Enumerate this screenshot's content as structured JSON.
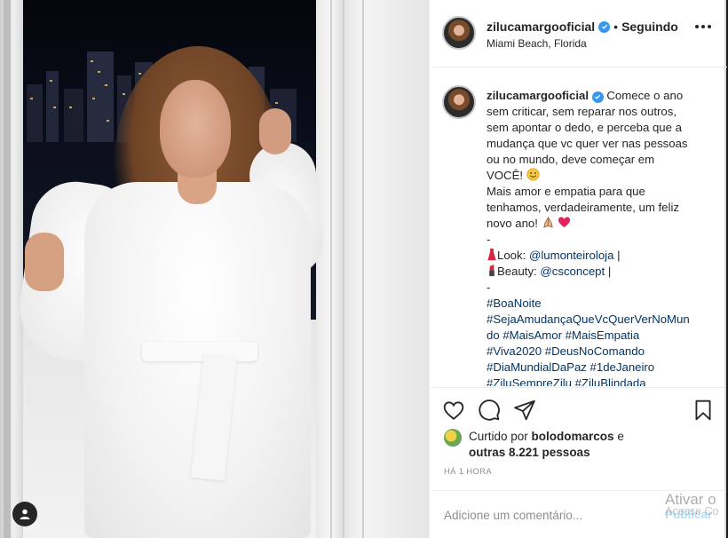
{
  "post": {
    "username": "zilucamargooficial",
    "separator": "•",
    "follow_status": "Seguindo",
    "location": "Miami Beach, Florida",
    "caption_lines": [
      "Comece o ano",
      "sem criticar, sem reparar nos outros,",
      "sem apontar o dedo, e perceba que a",
      "mudança que vc quer ver nas pessoas",
      "ou no mundo, deve começar em",
      "VOCÊ!",
      "Mais amor e empatia para que",
      "tenhamos, verdadeiramente, um feliz",
      "novo ano!",
      "-",
      "Look: ",
      "@lumonteiroloja",
      " |",
      "Beauty: ",
      "@csconcept",
      " |",
      "-"
    ],
    "hashtags": [
      "#BoaNoite",
      "#SejaAmudançaQueVcQuerVerNoMun",
      "do #MaisAmor #MaisEmpatia",
      "#Viva2020 #DeusNoComando",
      "#DiaMundialDaPaz #1deJaneiro",
      "#ZiluSempreZilu #ZiluBlindada"
    ]
  },
  "likes": {
    "prefix": "Curtido por ",
    "first_user": "bolodomarcos",
    "middle": " e",
    "others": "outras 8.221 pessoas"
  },
  "timestamp": "HÁ 1 HORA",
  "comment": {
    "placeholder": "Adicione um comentário...",
    "publish_label": "Publicar"
  },
  "watermark": {
    "line1": "Ativar o",
    "line2": "Acesse Co"
  },
  "icons": {
    "verified": "verified-badge-icon",
    "more": "more-options-icon",
    "like": "heart-icon",
    "comment": "comment-icon",
    "share": "paper-plane-icon",
    "save": "bookmark-icon",
    "user_tag": "user-tag-icon"
  },
  "colors": {
    "verified_blue": "#3897f0",
    "hashtag_link": "#003569",
    "publish_disabled": "#b2dffc",
    "text_primary": "#262626",
    "text_secondary": "#8e8e8e"
  }
}
